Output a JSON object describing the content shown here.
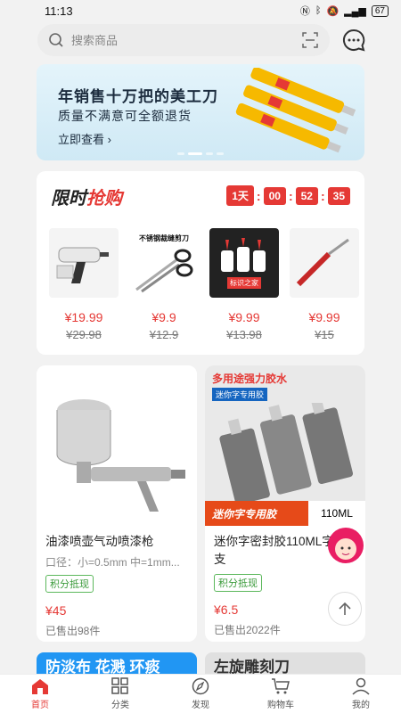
{
  "status_bar": {
    "time": "11:13",
    "battery": "67"
  },
  "search": {
    "placeholder": "搜索商品"
  },
  "banner": {
    "headline": "年销售十万把的美工刀",
    "subline": "质量不满意可全额退货",
    "cta": "立即查看 ›"
  },
  "flash_sale": {
    "title_a": "限时",
    "title_b": "抢购",
    "countdown": {
      "days": "1天",
      "hours": "00",
      "minutes": "52",
      "seconds": "35"
    },
    "items": [
      {
        "price": "¥19.99",
        "old_price": "¥29.98",
        "icon": "glue-gun"
      },
      {
        "price": "¥9.9",
        "old_price": "¥12.9",
        "icon": "scissors",
        "label": "不锈钢裁缝剪刀"
      },
      {
        "price": "¥9.99",
        "old_price": "¥13.98",
        "icon": "glue-bottles",
        "label": "标识之家"
      },
      {
        "price": "¥9.99",
        "old_price": "¥15",
        "icon": "soldering-iron"
      }
    ]
  },
  "products": [
    {
      "name": "油漆喷壶气动喷漆枪",
      "spec": "口径：小=0.5mm 中=1mm...",
      "badge": "积分抵现",
      "price": "¥45",
      "sold": "已售出98件"
    },
    {
      "name": "迷你字密封胶110ML字胶1支",
      "banner_top": "多用途强力胶水",
      "banner_sub": "迷你字专用胶",
      "bottom_left": "迷你字专用胶",
      "bottom_right": "110ML",
      "badge": "积分抵现",
      "price": "¥6.5",
      "sold": "已售出2022件"
    }
  ],
  "peek": {
    "left": "防淡布 花溅 环痰",
    "right": "左旋雕刻刀"
  },
  "tabs": [
    {
      "label": "首页",
      "icon": "home-icon"
    },
    {
      "label": "分类",
      "icon": "category-icon"
    },
    {
      "label": "发现",
      "icon": "compass-icon"
    },
    {
      "label": "购物车",
      "icon": "cart-icon"
    },
    {
      "label": "我的",
      "icon": "profile-icon"
    }
  ],
  "colors": {
    "accent": "#e53935",
    "badge": "#5cb85c"
  }
}
